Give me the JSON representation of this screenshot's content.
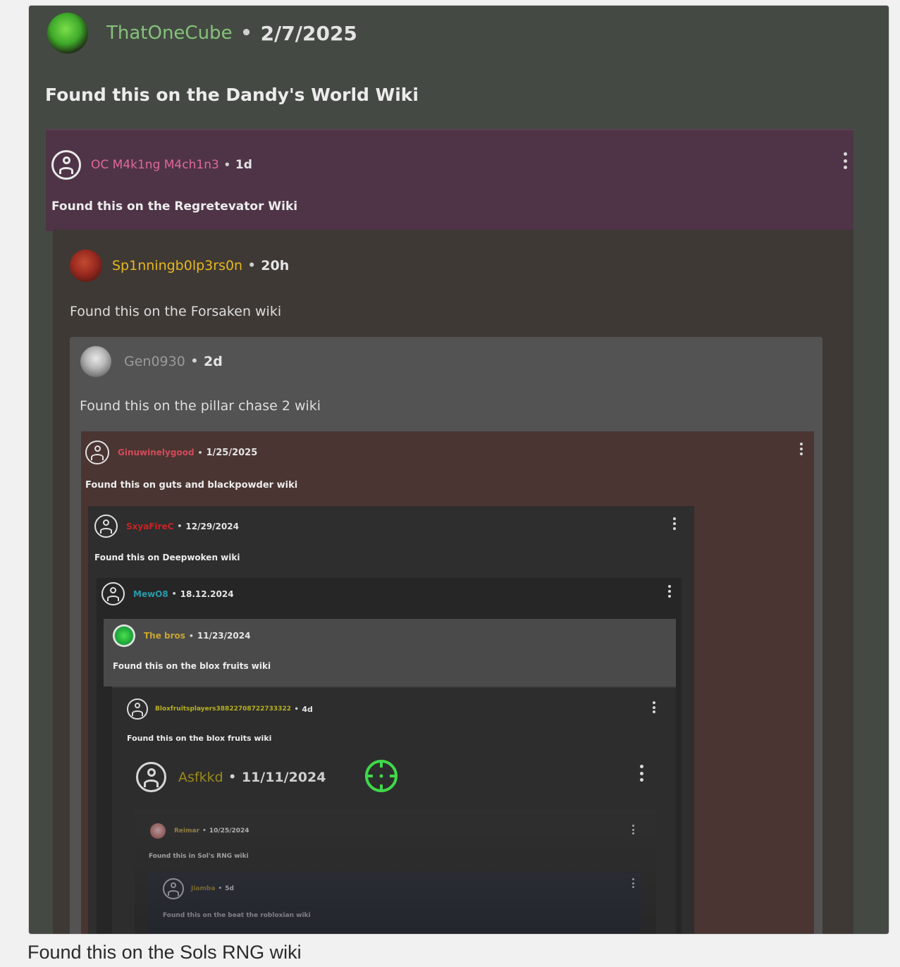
{
  "post": {
    "author": "ThatOneCube",
    "date": "2/7/2025",
    "text": "Found this on the Dandy's World Wiki"
  },
  "nested": [
    {
      "author": "OC M4k1ng M4ch1n3",
      "date": "1d",
      "text": "Found this on the Regretevator Wiki",
      "name_color": "#e0689e"
    },
    {
      "author": "Sp1nningb0lp3rs0n",
      "date": "20h",
      "text": "Found this on the Forsaken wiki",
      "name_color": "#e8b820"
    },
    {
      "author": "Gen0930",
      "date": "2d",
      "text": "Found this on the pillar  chase 2 wiki",
      "name_color": "#9a9a9a"
    },
    {
      "author": "Ginuwinelygood",
      "date": "1/25/2025",
      "text": "Found this on guts and blackpowder wiki",
      "name_color": "#d24a5a"
    },
    {
      "author": "SxyaFireC",
      "date": "12/29/2024",
      "text": "Found this on Deepwoken wiki",
      "name_color": "#cc2222"
    },
    {
      "author": "MewO8",
      "date": "18.12.2024",
      "text": "",
      "name_color": "#2a9aa8"
    },
    {
      "author": "The bros",
      "date": "11/23/2024",
      "text": "Found this on the blox fruits wiki",
      "name_color": "#c9a530"
    },
    {
      "author": "Bloxfruitsplayers38822708722733322",
      "date": "4d",
      "text": "Found this on the blox fruits wiki",
      "name_color": "#b8b020"
    },
    {
      "author": "Asfkkd",
      "date": "11/11/2024",
      "text": "",
      "name_color": "#9a8a1a"
    },
    {
      "author": "Reimar",
      "date": "10/25/2024",
      "text": "Found this in Sol's RNG wiki",
      "name_color": "#b8a050"
    },
    {
      "author": "Jiamba",
      "date": "5d",
      "text": "Found this on the beat the robloxian wiki",
      "name_color": "#a89030"
    }
  ],
  "caption": "Found this on the Sols RNG wiki",
  "icons": {
    "default_avatar": "user-circle-icon",
    "more": "kebab-menu-icon",
    "target": "crosshair-icon"
  }
}
